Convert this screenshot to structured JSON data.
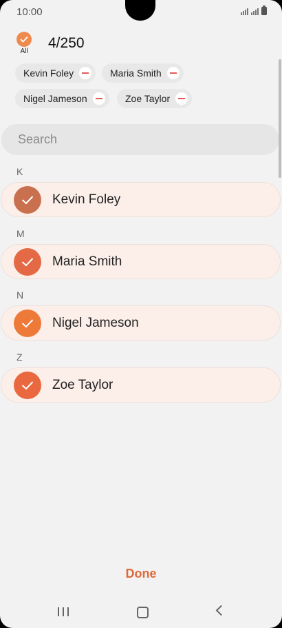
{
  "status_bar": {
    "time": "10:00"
  },
  "header": {
    "all_label": "All",
    "count": "4/250"
  },
  "selected_chips": [
    "Kevin Foley",
    "Maria Smith",
    "Nigel Jameson",
    "Zoe Taylor"
  ],
  "search": {
    "placeholder": "Search"
  },
  "sections": [
    {
      "letter": "K",
      "contact": "Kevin Foley",
      "check_color": "#c9714f"
    },
    {
      "letter": "M",
      "contact": "Maria Smith",
      "check_color": "#e36a45"
    },
    {
      "letter": "N",
      "contact": "Nigel Jameson",
      "check_color": "#ee7a39"
    },
    {
      "letter": "Z",
      "contact": "Zoe Taylor",
      "check_color": "#e9683f"
    }
  ],
  "actions": {
    "done_label": "Done"
  },
  "colors": {
    "accent": "#e0683a",
    "row_background": "#fcefe9",
    "chip_remove": "#e05a56"
  }
}
